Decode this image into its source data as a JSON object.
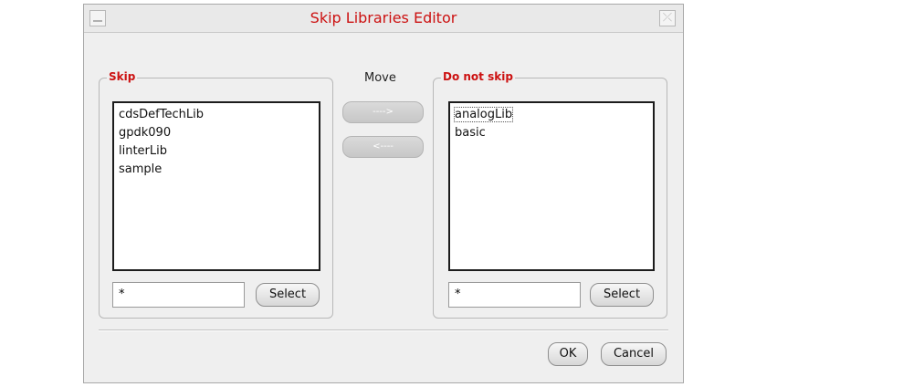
{
  "window": {
    "title": "Skip Libraries Editor",
    "close_glyph": "⤫"
  },
  "skip": {
    "label": "Skip",
    "items": [
      "cdsDefTechLib",
      "gpdk090",
      "linterLib",
      "sample"
    ],
    "filter_value": "*",
    "select_label": "Select"
  },
  "move": {
    "label": "Move",
    "right_label": "---->",
    "left_label": "<----"
  },
  "do_not_skip": {
    "label": "Do not skip",
    "items": [
      "analogLib",
      "basic"
    ],
    "filter_value": "*",
    "select_label": "Select"
  },
  "footer": {
    "ok_label": "OK",
    "cancel_label": "Cancel"
  },
  "colors": {
    "accent": "#cc1111",
    "window_bg": "#efefef"
  },
  "icons": {
    "minimize": "minimize-icon",
    "close": "close-icon"
  }
}
